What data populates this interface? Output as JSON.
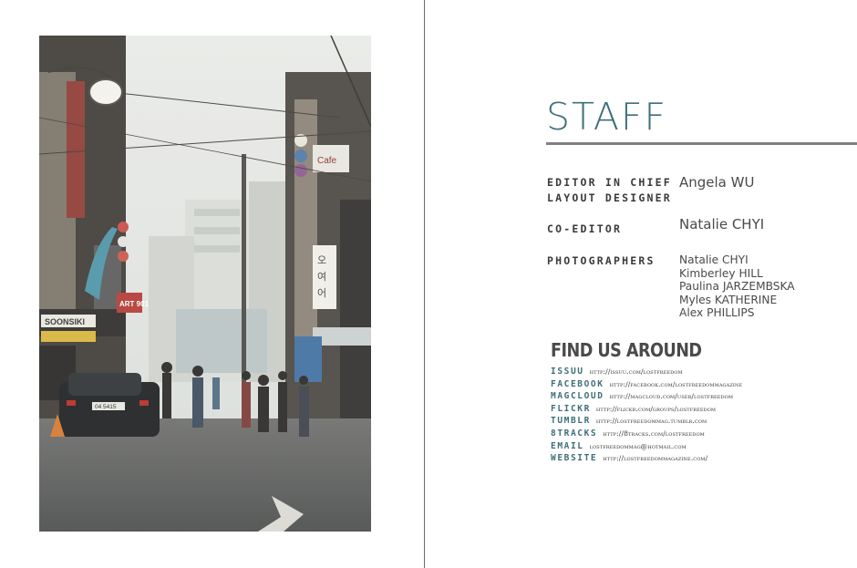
{
  "right_page": {
    "title": "STAFF",
    "staff": [
      {
        "roles": [
          "EDITOR IN CHIEF",
          "LAYOUT DESIGNER"
        ],
        "names": [
          "Angela WU"
        ]
      },
      {
        "roles": [
          "CO-EDITOR"
        ],
        "names": [
          "Natalie CHYI"
        ]
      },
      {
        "roles": [
          "PHOTOGRAPHERS"
        ],
        "names": [
          "Natalie CHYI",
          "Kimberley HILL",
          "Paulina JARZEMBSKA",
          "Myles KATHERINE",
          "Alex PHILLIPS"
        ]
      }
    ],
    "find_us": {
      "title": "FIND US AROUND",
      "links": [
        {
          "label": "ISSUU",
          "url": "http://issuu.com/lostfreedom"
        },
        {
          "label": "FACEBOOK",
          "url": "http://facebook.com/lostfreedommagazine"
        },
        {
          "label": "MAGCLOUD",
          "url": "http://magcloud.com/user/lostfreedom"
        },
        {
          "label": "FLICKR",
          "url": "http://flickr.com/groups/lostfreedom"
        },
        {
          "label": "TUMBLR",
          "url": "http://lostfreedommag.tumblr.com"
        },
        {
          "label": "8TRACKS",
          "url": "http://8tracks.com/lostfreedom"
        },
        {
          "label": "EMAIL",
          "url": "lostfreedommag@hotmail.com"
        },
        {
          "label": "WEBSITE",
          "url": "http://lostfreedommagazine.com/"
        }
      ]
    }
  },
  "photo": {
    "sign_texts": [
      "SOONSIKI",
      "ART 901",
      "Cafe",
      "오",
      "여",
      "어"
    ],
    "car_plate": "04 5415"
  },
  "colors": {
    "accent": "#3d6f78",
    "rule": "#808080",
    "spine": "#6b6b6b"
  }
}
